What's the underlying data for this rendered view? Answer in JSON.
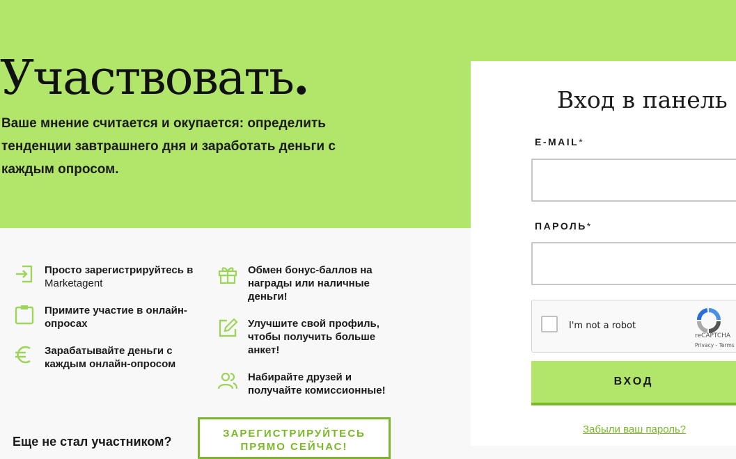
{
  "hero": {
    "title": "Участвовать",
    "title_dot": ".",
    "subtitle": "Ваше мнение считается и окупается: определить тенденции завтрашнего дня и заработать деньги с каждым опросом."
  },
  "features_left": [
    {
      "icon": "login-icon",
      "text": "Просто зарегистрируйтесь в",
      "brand": "Marketagent"
    },
    {
      "icon": "clipboard-icon",
      "text": "Примите участие в онлайн-опросах"
    },
    {
      "icon": "euro-icon",
      "text": "Зарабатывайте деньги с каждым онлайн-опросом"
    }
  ],
  "features_right": [
    {
      "icon": "gift-icon",
      "text": "Обмен бонус-баллов на награды или наличные деньги!"
    },
    {
      "icon": "edit-icon",
      "text": "Улучшите свой профиль, чтобы получить больше анкет!"
    },
    {
      "icon": "users-icon",
      "text": "Набирайте друзей и получайте комиссионные!"
    }
  ],
  "cta": {
    "question": "Еще не стал участником?",
    "button": "ЗАРЕГИСТРИРУЙТЕСЬ ПРЯМО СЕЙЧАС!"
  },
  "login": {
    "title": "Вход в панель",
    "email_label": "E-MAIL",
    "password_label": "ПАРОЛЬ",
    "required_mark": "*",
    "email_value": "",
    "password_value": "",
    "captcha_text": "I'm not a robot",
    "captcha_brand": "reCAPTCHA",
    "captcha_links": "Privacy - Terms",
    "button": "ВХОД",
    "forgot": "Забыли ваш пароль?"
  },
  "colors": {
    "accent": "#b1e66b",
    "accent_dark": "#7ab829",
    "background": "#f8f8f8"
  }
}
